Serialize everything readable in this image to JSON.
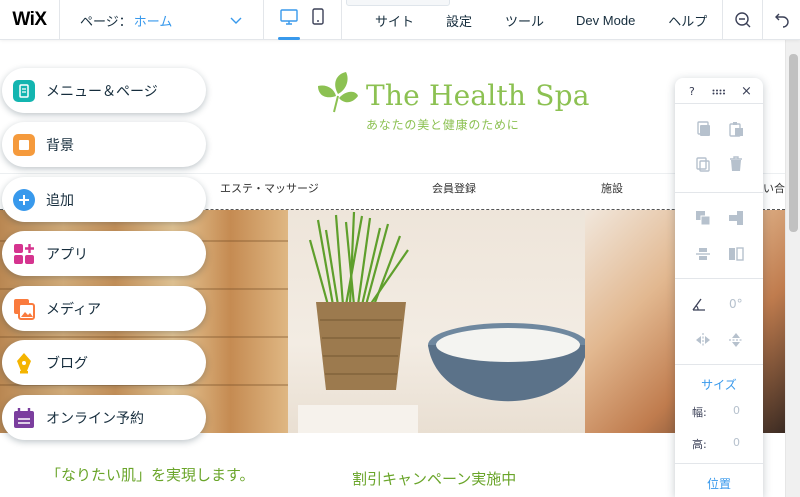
{
  "app": {
    "logo": "WiX"
  },
  "topbar": {
    "page_label": "ページ：",
    "page_value": "ホーム",
    "menu": [
      {
        "name": "menu-site",
        "label": "サイト"
      },
      {
        "name": "menu-settings",
        "label": "設定"
      },
      {
        "name": "menu-tools",
        "label": "ツール"
      },
      {
        "name": "menu-dev-mode",
        "label": "Dev Mode"
      },
      {
        "name": "menu-help",
        "label": "ヘルプ"
      }
    ]
  },
  "left_panel": [
    {
      "name": "menus-pages-button",
      "label": "メニュー＆ページ",
      "icon": "pages-icon",
      "color": "#13b5b0"
    },
    {
      "name": "background-button",
      "label": "背景",
      "icon": "background-icon",
      "color": "#f59a3c"
    },
    {
      "name": "add-button",
      "label": "追加",
      "icon": "plus-icon",
      "color": "#3899ec"
    },
    {
      "name": "apps-button",
      "label": "アプリ",
      "icon": "apps-icon",
      "color": "#d5348f"
    },
    {
      "name": "media-button",
      "label": "メディア",
      "icon": "media-icon",
      "color": "#fa7b3e"
    },
    {
      "name": "blog-button",
      "label": "ブログ",
      "icon": "pen-icon",
      "color": "#f4b400"
    },
    {
      "name": "bookings-button",
      "label": "オンライン予約",
      "icon": "calendar-icon",
      "color": "#7b3e9e"
    }
  ],
  "site": {
    "title": "The Health Spa",
    "tagline": "あなたの美と健康のために",
    "nav": [
      "エステ・マッサージ",
      "会員登録",
      "施設",
      "問い合"
    ],
    "promo_left": "「なりたい肌」を実現します。",
    "promo_right": "割引キャンペーン実施中"
  },
  "toolbar": {
    "help": "?",
    "close": "×",
    "angle": "0°",
    "size_title": "サイズ",
    "width_label": "幅:",
    "width_value": "0",
    "height_label": "高:",
    "height_value": "0",
    "position_title": "位置"
  },
  "colors": {
    "accent": "#3899ec",
    "brand_green": "#8cc152"
  }
}
